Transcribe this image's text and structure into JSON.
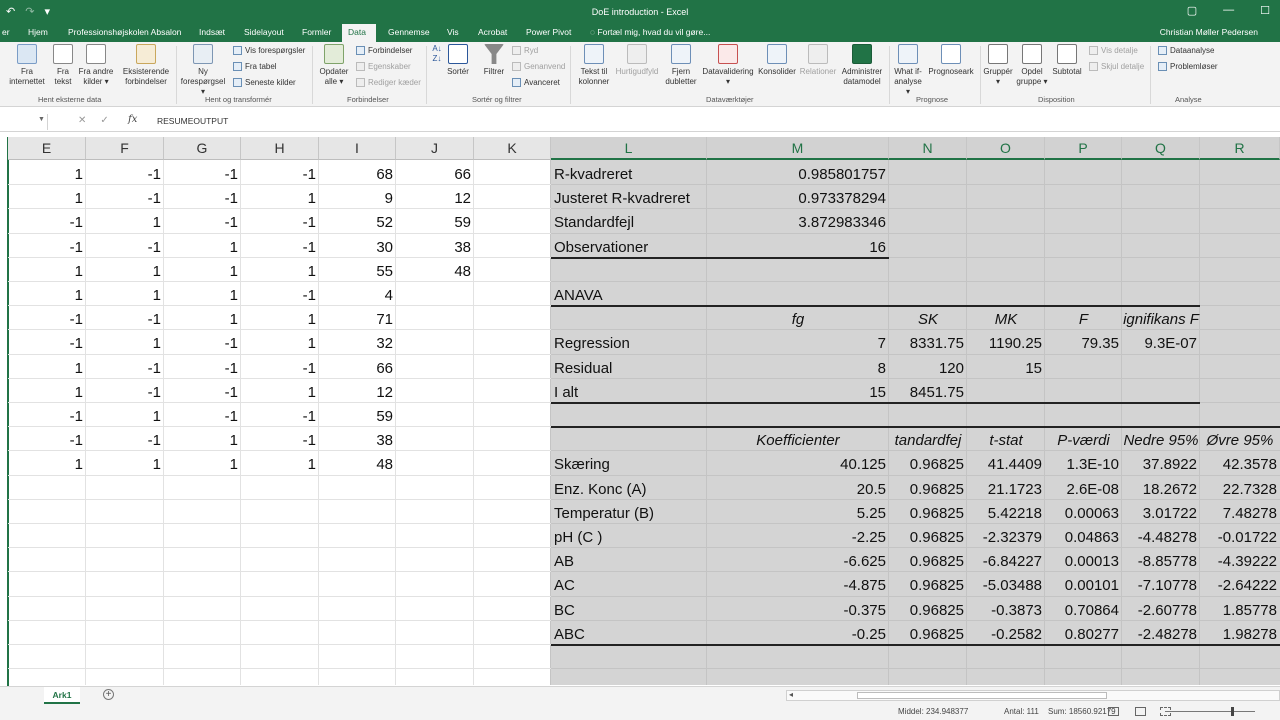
{
  "titlebar": {
    "title": "DoE introduction - Excel",
    "undo": "↶",
    "redo": "↷",
    "customize": "▾",
    "restore": "▢",
    "minimize": "—",
    "maximize": "☐"
  },
  "tabs": [
    "er",
    "Hjem",
    "Professionshøjskolen Absalon",
    "Indsæt",
    "Sidelayout",
    "Formler",
    "Data",
    "Gennemse",
    "Vis",
    "Acrobat",
    "Power Pivot",
    "Fortæl mig, hvad du vil gøre..."
  ],
  "active_tab": "Data",
  "user": "Christian Møller Pedersen",
  "ribbon": {
    "hent_eksterne": {
      "fra_internettet": "Fra internettet",
      "fra_tekst": "Fra tekst",
      "fra_andre": "Fra andre kilder ▾",
      "eksisterende": "Eksisterende forbindelser",
      "label": "Hent eksterne data"
    },
    "hent_og_transformer": {
      "ny": "Ny forespørgsel ▾",
      "vis_foresp": "Vis forespørgsler",
      "fra_tabel": "Fra tabel",
      "seneste": "Seneste kilder",
      "label": "Hent og transformér"
    },
    "forbindelser": {
      "opdater": "Opdater alle ▾",
      "forbindelser": "Forbindelser",
      "egenskaber": "Egenskaber",
      "rediger": "Rediger kæder",
      "label": "Forbindelser"
    },
    "sorter": {
      "sorter": "Sortér",
      "filtrer": "Filtrer",
      "ryd": "Ryd",
      "genanvend": "Genanvend",
      "avanceret": "Avanceret",
      "label": "Sortér og filtrer"
    },
    "datavaerktojer": {
      "tekst": "Tekst til kolonner",
      "hurtig": "Hurtigudfyld",
      "fjern": "Fjern dubletter",
      "validering": "Datavalidering ▾",
      "konsolider": "Konsolider",
      "relationer": "Relationer",
      "administrer": "Administrer datamodel",
      "label": "Dataværktøjer"
    },
    "prognose": {
      "whatif": "What if-analyse ▾",
      "prognoseark": "Prognoseark",
      "label": "Prognose"
    },
    "disposition": {
      "grupper": "Gruppér ▾",
      "opdel": "Opdel gruppe ▾",
      "subtotal": "Subtotal",
      "vis": "Vis detalje",
      "skjul": "Skjul detalje",
      "label": "Disposition"
    },
    "analyse": {
      "dataanalyse": "Dataanalyse",
      "problemloser": "Problemløser",
      "label": "Analyse"
    }
  },
  "formula_bar": {
    "name_box": "",
    "content": "RESUMEOUTPUT",
    "fx": "fx",
    "cancel": "✕",
    "enter": "✓"
  },
  "columns": [
    "E",
    "F",
    "G",
    "H",
    "I",
    "J",
    "K",
    "L",
    "M",
    "N",
    "O",
    "P",
    "Q",
    "R"
  ],
  "left_rows": [
    [
      "1",
      "-1",
      "-1",
      "-1",
      "68",
      "66"
    ],
    [
      "1",
      "-1",
      "-1",
      "1",
      "9",
      "12"
    ],
    [
      "-1",
      "1",
      "-1",
      "-1",
      "52",
      "59"
    ],
    [
      "-1",
      "-1",
      "1",
      "-1",
      "30",
      "38"
    ],
    [
      "1",
      "1",
      "1",
      "1",
      "55",
      "48"
    ],
    [
      "1",
      "1",
      "1",
      "-1",
      "4",
      ""
    ],
    [
      "-1",
      "-1",
      "1",
      "1",
      "71",
      ""
    ],
    [
      "-1",
      "1",
      "-1",
      "1",
      "32",
      ""
    ],
    [
      "1",
      "-1",
      "-1",
      "-1",
      "66",
      ""
    ],
    [
      "1",
      "-1",
      "-1",
      "1",
      "12",
      ""
    ],
    [
      "-1",
      "1",
      "-1",
      "-1",
      "59",
      ""
    ],
    [
      "-1",
      "-1",
      "1",
      "-1",
      "38",
      ""
    ],
    [
      "1",
      "1",
      "1",
      "1",
      "48",
      ""
    ]
  ],
  "regression_stats": [
    {
      "label": "R-kvadreret",
      "value": "0.985801757"
    },
    {
      "label": "Justeret R-kvadreret",
      "value": "0.973378294"
    },
    {
      "label": "Standardfejl",
      "value": "3.872983346"
    },
    {
      "label": "Observationer",
      "value": "16"
    }
  ],
  "anova": {
    "title": "ANAVA",
    "headers": [
      "",
      "fg",
      "SK",
      "MK",
      "F",
      "ignifikans F"
    ],
    "rows": [
      [
        "Regression",
        "7",
        "8331.75",
        "1190.25",
        "79.35",
        "9.3E-07"
      ],
      [
        "Residual",
        "8",
        "120",
        "15",
        "",
        ""
      ],
      [
        "I alt",
        "15",
        "8451.75",
        "",
        "",
        ""
      ]
    ]
  },
  "coefficients": {
    "headers": [
      "",
      "Koefficienter",
      "tandardfej",
      "t-stat",
      "P-værdi",
      "Nedre 95%",
      "Øvre 95% "
    ],
    "rows": [
      [
        "Skæring",
        "40.125",
        "0.96825",
        "41.4409",
        "1.3E-10",
        "37.8922",
        "42.3578"
      ],
      [
        "Enz. Konc (A)",
        "20.5",
        "0.96825",
        "21.1723",
        "2.6E-08",
        "18.2672",
        "22.7328"
      ],
      [
        "Temperatur (B)",
        "5.25",
        "0.96825",
        "5.42218",
        "0.00063",
        "3.01722",
        "7.48278"
      ],
      [
        "pH (C )",
        "-2.25",
        "0.96825",
        "-2.32379",
        "0.04863",
        "-4.48278",
        "-0.01722"
      ],
      [
        "AB",
        "-6.625",
        "0.96825",
        "-6.84227",
        "0.00013",
        "-8.85778",
        "-4.39222"
      ],
      [
        "AC",
        "-4.875",
        "0.96825",
        "-5.03488",
        "0.00101",
        "-7.10778",
        "-2.64222"
      ],
      [
        "BC",
        "-0.375",
        "0.96825",
        "-0.3873",
        "0.70864",
        "-2.60778",
        "1.85778"
      ],
      [
        "ABC",
        "-0.25",
        "0.96825",
        "-0.2582",
        "0.80277",
        "-2.48278",
        "1.98278"
      ]
    ]
  },
  "sheet": {
    "name": "Ark1",
    "add": "+"
  },
  "status": {
    "middel": "Middel: 234.948377",
    "antal": "Antal: 111",
    "sum": "Sum: 18560.92179"
  },
  "colors": {
    "excel_green": "#217346",
    "selection_gray": "#d4d4d4"
  }
}
